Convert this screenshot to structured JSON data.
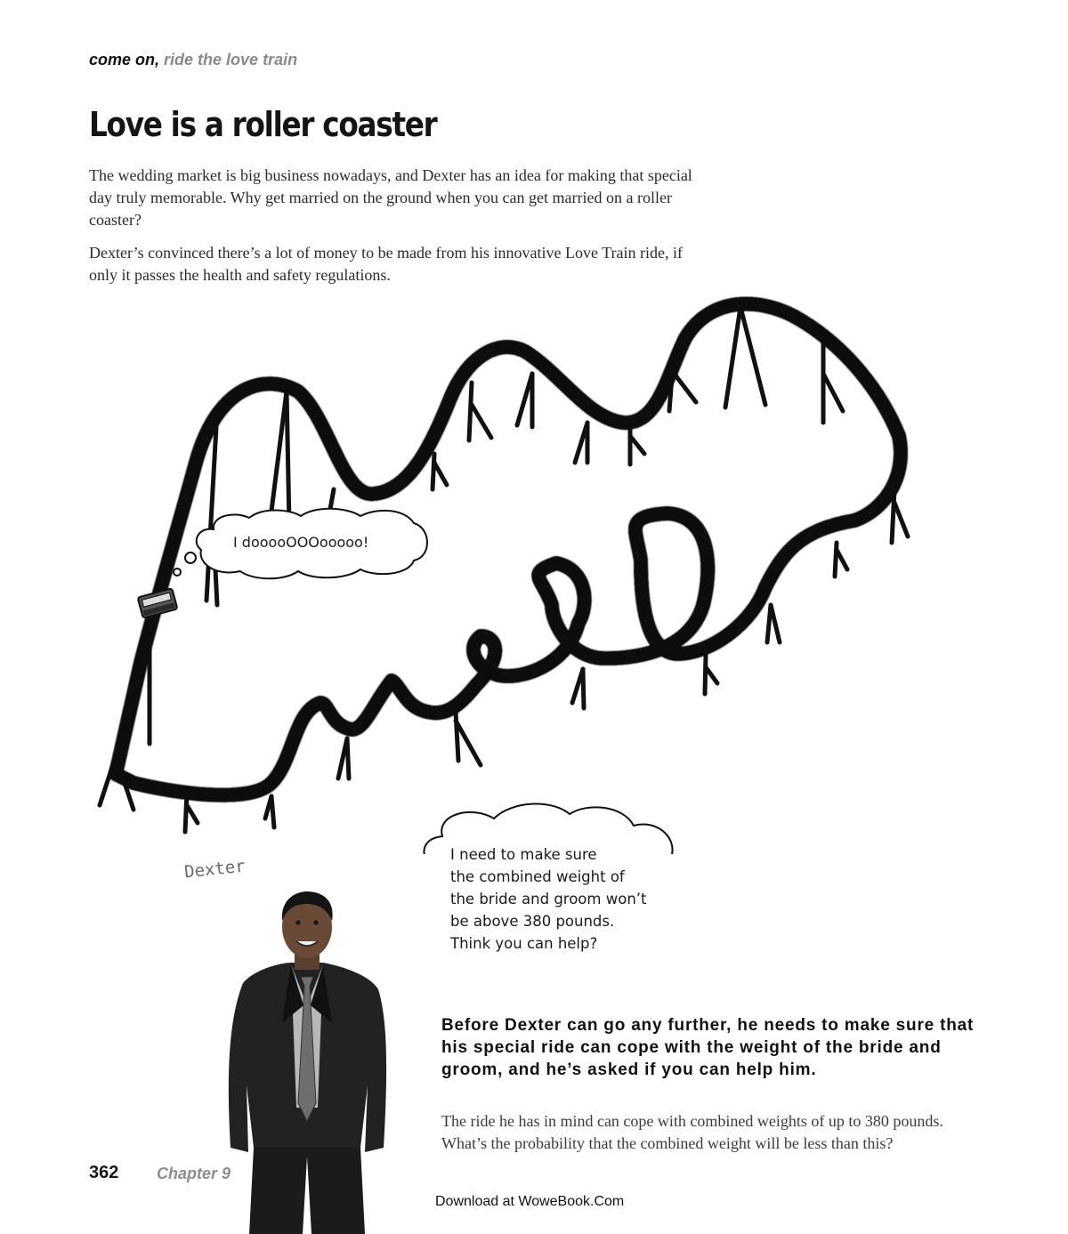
{
  "header": {
    "prefix": "come on,",
    "section": "ride the love train"
  },
  "title": "Love is a roller coaster",
  "paragraphs": [
    "The wedding market is big business nowadays, and Dexter has an idea for making that special day truly memorable. Why get married on the ground when you can get married on a roller coaster?",
    "Dexter’s convinced there’s a lot of money to be made from his innovative Love Train ride, if only it passes the health and safety regulations."
  ],
  "bubbles": {
    "rider": "I dooooOOOooooo!",
    "dexter": "I need to make sure\nthe combined weight of\nthe bride and groom won’t\nbe above 380 pounds.\nThink you can help?"
  },
  "labels": {
    "dexter": "Dexter"
  },
  "callout": {
    "bold": "Before Dexter can go any further, he needs to make sure that his special ride can cope with the weight of the bride and groom, and he’s asked if you can help him.",
    "body": "The ride he has in mind can cope with combined weights of up to 380 pounds. What’s the probability that the combined weight will be less than this?"
  },
  "footer": {
    "page_number": "362",
    "chapter": "Chapter 9",
    "download": "Download at WoweBook.Com"
  }
}
